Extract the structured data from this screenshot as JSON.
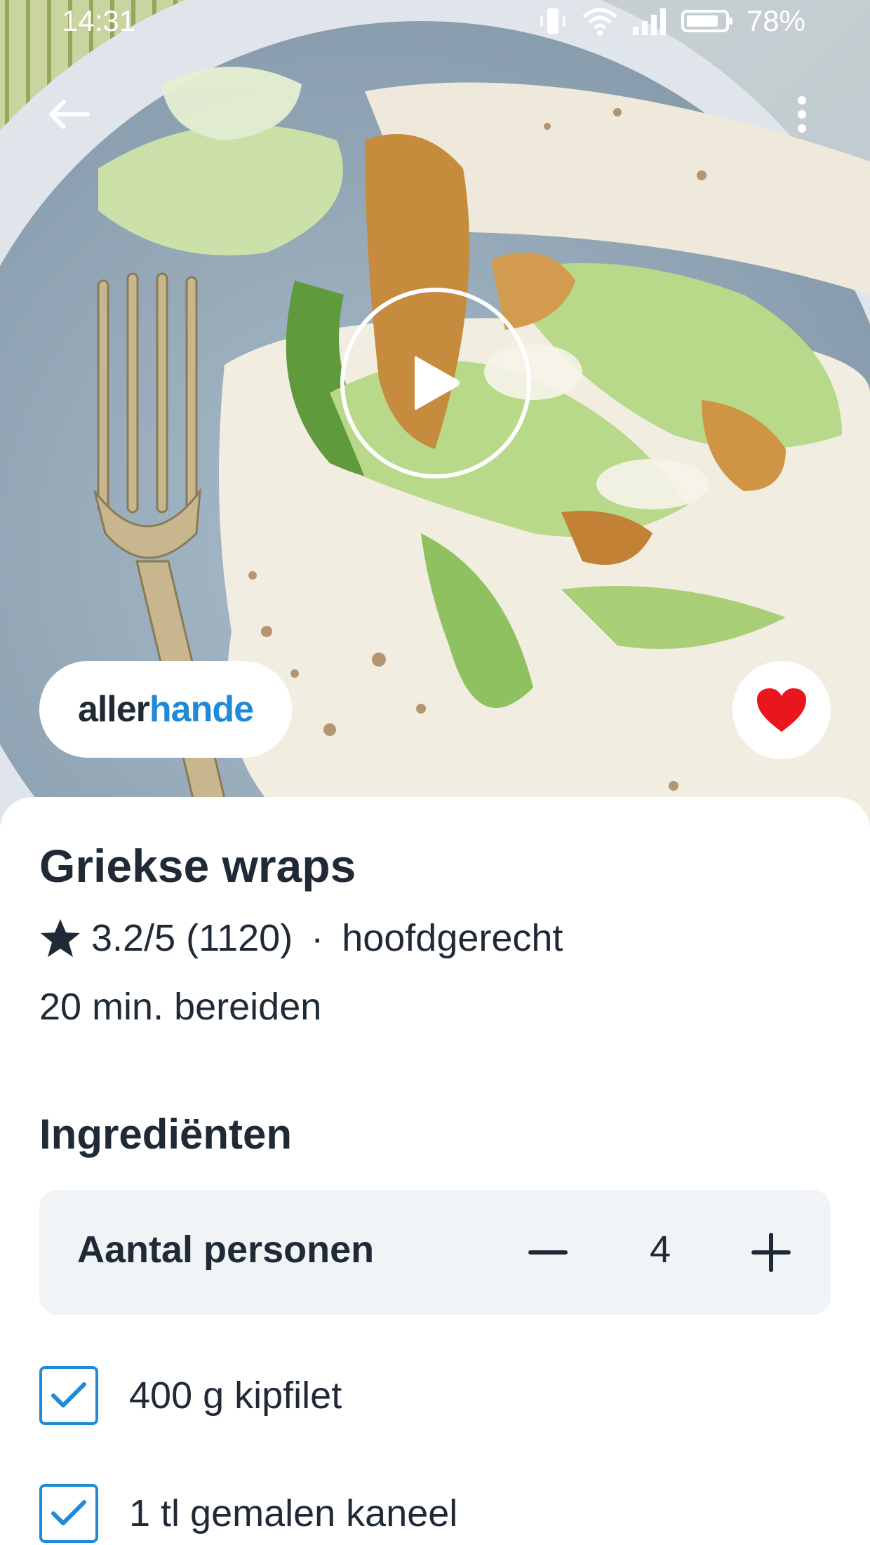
{
  "status_bar": {
    "time": "14:31",
    "battery": "78%"
  },
  "hero": {
    "icons": [
      "back-arrow-icon",
      "more-vert-icon",
      "play-icon",
      "heart-icon"
    ]
  },
  "brand": {
    "part1": "aller",
    "part2": "hande"
  },
  "recipe": {
    "title": "Griekse wraps",
    "rating": "3.2/5 (1120)",
    "separator": "·",
    "category": "hoofdgerecht",
    "prep_time": "20 min. bereiden"
  },
  "ingredients": {
    "heading": "Ingrediënten",
    "servings_label": "Aantal personen",
    "servings_count": "4",
    "items": [
      {
        "label": "400 g kipfilet",
        "checked": true
      },
      {
        "label": "1 tl gemalen kaneel",
        "checked": true
      }
    ]
  },
  "colors": {
    "accent": "#1f8ad8",
    "heart": "#e8161d",
    "text": "#1f2a36",
    "panel": "#f1f4f7"
  }
}
